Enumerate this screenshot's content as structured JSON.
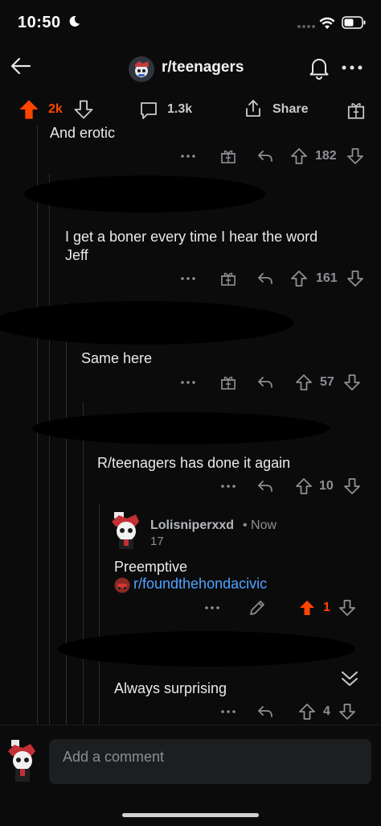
{
  "status": {
    "time": "10:50"
  },
  "header": {
    "subreddit": "r/teenagers"
  },
  "action_bar": {
    "votes": "2k",
    "comments": "1.3k",
    "share_label": "Share"
  },
  "comments": [
    {
      "id": "c1",
      "text": "And erotic",
      "score": "182"
    },
    {
      "id": "c2",
      "text_line1": "I get a boner every time I hear the word",
      "text_line2": "Jeff",
      "score": "161"
    },
    {
      "id": "c3",
      "text": "Same here",
      "score": "57"
    },
    {
      "id": "c4",
      "text": "R/teenagers has done it again",
      "score": "10"
    },
    {
      "id": "c5",
      "username": "Lolisniperxxd",
      "time": "• Now",
      "flair": "17",
      "text": "Preemptive",
      "link": "r/foundthehondacivic",
      "score": "1"
    },
    {
      "id": "c6",
      "text": "Always surprising",
      "score": "4"
    }
  ],
  "composer": {
    "placeholder": "Add a comment"
  },
  "colors": {
    "upvote": "#ff4500",
    "link": "#4fa3ff",
    "background": "#0b0b0c"
  }
}
